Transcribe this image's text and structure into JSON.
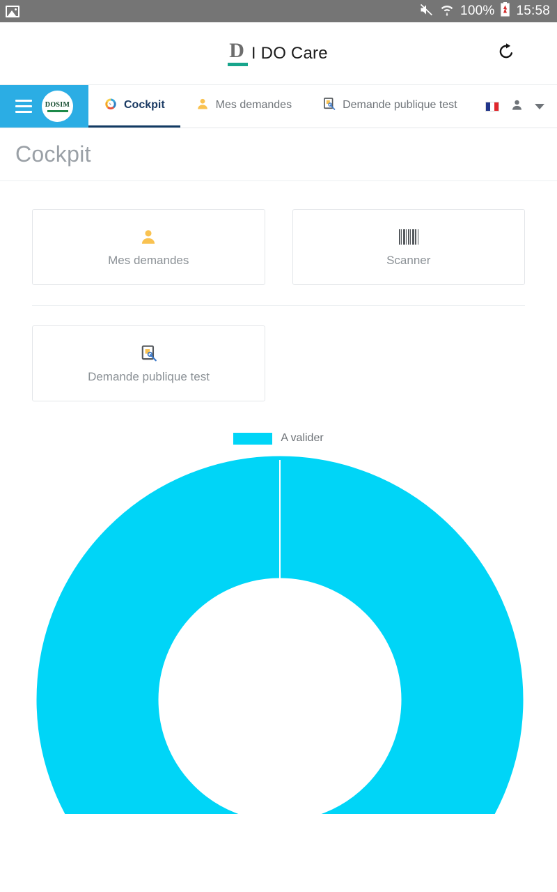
{
  "statusbar": {
    "photo_icon": "photo-icon",
    "mute_icon": "volume-mute-icon",
    "wifi_icon": "wifi-transfer-icon",
    "battery_text": "100%",
    "battery_icon": "battery-low-icon",
    "time": "15:58"
  },
  "appbar": {
    "logo_letter": "D",
    "title": "I DO Care",
    "refresh_icon": "refresh-icon"
  },
  "navbar": {
    "menu_icon": "hamburger-menu-icon",
    "logo_text": "DOSIM",
    "tabs": [
      {
        "label": "Cockpit",
        "icon": "gauge-icon",
        "active": true
      },
      {
        "label": "Mes demandes",
        "icon": "person-icon",
        "active": false
      },
      {
        "label": "Demande publique test",
        "icon": "document-search-icon",
        "active": false
      }
    ],
    "language_icon": "french-flag-icon",
    "user_icon": "user-account-icon",
    "caret_icon": "chevron-down-icon"
  },
  "page": {
    "title": "Cockpit"
  },
  "cards": [
    {
      "label": "Mes demandes",
      "icon": "person-icon"
    },
    {
      "label": "Scanner",
      "icon": "barcode-icon"
    },
    {
      "label": "Demande publique test",
      "icon": "document-search-icon"
    }
  ],
  "colors": {
    "nav_blue": "#2bade4",
    "chart_cyan": "#00d5f7",
    "brand_green": "#17a58c",
    "accent_yellow": "#fbc košik"
  },
  "chart_data": {
    "type": "pie",
    "variant": "donut",
    "title": "",
    "legend_position": "top",
    "categories": [
      "A valider"
    ],
    "values": [
      100
    ],
    "units": "%",
    "colors": [
      "#00d5f7"
    ],
    "series": [
      {
        "name": "A valider",
        "values": [
          100
        ]
      }
    ],
    "labels_shown": false,
    "start_angle": 90,
    "inner_radius_ratio": 0.5
  }
}
